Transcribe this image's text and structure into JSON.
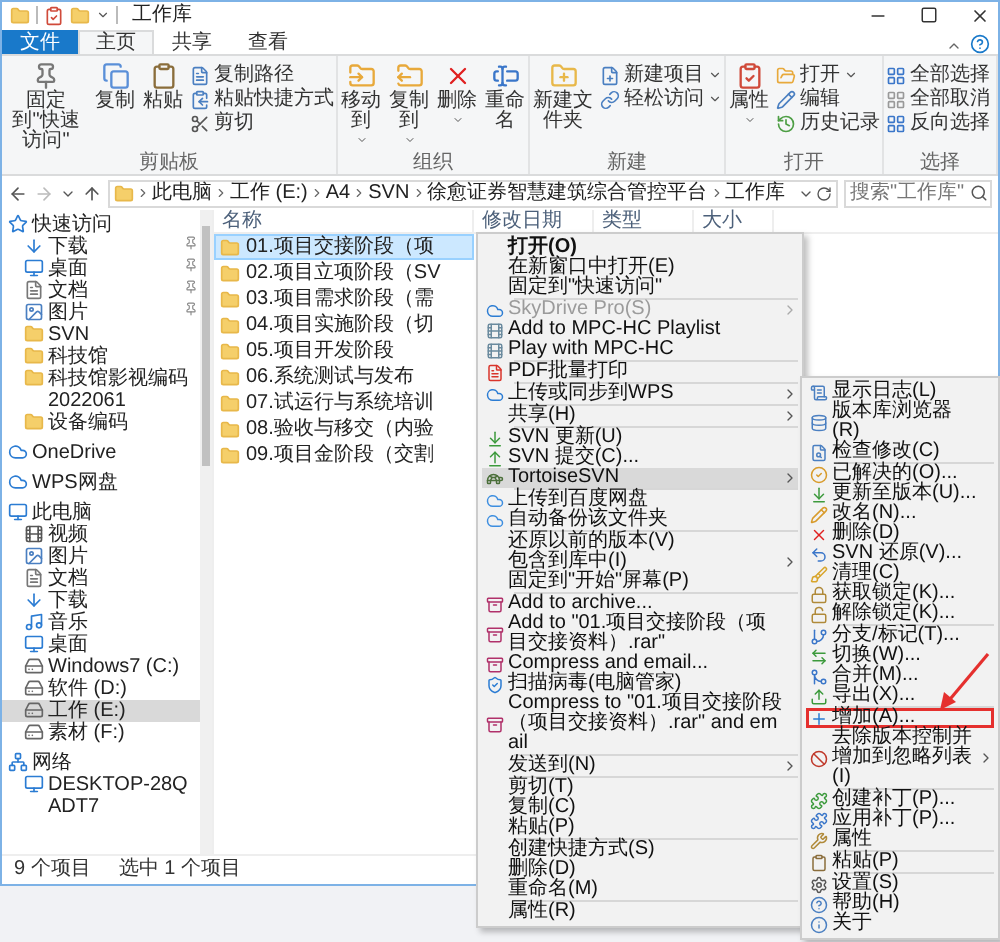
{
  "window": {
    "title": "工作库"
  },
  "ribbon_tabs": [
    {
      "label": "文件",
      "kind": "file",
      "selected": false
    },
    {
      "label": "主页",
      "kind": "tab",
      "selected": true
    },
    {
      "label": "共享",
      "kind": "tab",
      "selected": false
    },
    {
      "label": "查看",
      "kind": "tab",
      "selected": false
    }
  ],
  "ribbon": {
    "groups": [
      {
        "label": "剪贴板",
        "items": [
          {
            "kind": "large",
            "label": "固定到\"快速访问\"",
            "dropdown": false
          },
          {
            "kind": "large",
            "label": "复制",
            "dropdown": false
          },
          {
            "kind": "large",
            "label": "粘贴",
            "dropdown": false
          },
          {
            "kind": "small",
            "label": "复制路径",
            "dropdown": false
          },
          {
            "kind": "small",
            "label": "粘贴快捷方式",
            "dropdown": false
          },
          {
            "kind": "small",
            "label": "剪切",
            "dropdown": false
          }
        ]
      },
      {
        "label": "组织",
        "items": [
          {
            "kind": "large",
            "label": "移动到",
            "dropdown": true
          },
          {
            "kind": "large",
            "label": "复制到",
            "dropdown": true
          },
          {
            "kind": "large",
            "label": "删除",
            "dropdown": true
          },
          {
            "kind": "large",
            "label": "重命名",
            "dropdown": false
          }
        ]
      },
      {
        "label": "新建",
        "items": [
          {
            "kind": "large",
            "label": "新建文件夹",
            "dropdown": false
          },
          {
            "kind": "small",
            "label": "新建项目",
            "dropdown": true
          },
          {
            "kind": "small",
            "label": "轻松访问",
            "dropdown": true
          }
        ]
      },
      {
        "label": "打开",
        "items": [
          {
            "kind": "large",
            "label": "属性",
            "dropdown": true
          },
          {
            "kind": "small",
            "label": "打开",
            "dropdown": true
          },
          {
            "kind": "small",
            "label": "编辑",
            "dropdown": false
          },
          {
            "kind": "small",
            "label": "历史记录",
            "dropdown": false
          }
        ]
      },
      {
        "label": "选择",
        "items": [
          {
            "kind": "small",
            "label": "全部选择",
            "dropdown": false
          },
          {
            "kind": "small",
            "label": "全部取消",
            "dropdown": false
          },
          {
            "kind": "small",
            "label": "反向选择",
            "dropdown": false
          }
        ]
      }
    ]
  },
  "address": {
    "segments": [
      "此电脑",
      "工作 (E:)",
      "A4",
      "SVN",
      "徐愈证券智慧建筑综合管控平台",
      "工作库"
    ],
    "search_placeholder": "搜索\"工作库\""
  },
  "navigation": [
    {
      "label": "快速访问",
      "selected": false,
      "children": [
        {
          "label": "下载",
          "selected": false,
          "pinned": true
        },
        {
          "label": "桌面",
          "selected": false,
          "pinned": true
        },
        {
          "label": "文档",
          "selected": false,
          "pinned": true
        },
        {
          "label": "图片",
          "selected": false,
          "pinned": true
        },
        {
          "label": "SVN",
          "selected": false,
          "pinned": false
        },
        {
          "label": "科技馆",
          "selected": false,
          "pinned": false
        },
        {
          "label": "科技馆影视编码2022061",
          "selected": false,
          "pinned": false
        },
        {
          "label": "设备编码",
          "selected": false,
          "pinned": false
        }
      ]
    },
    {
      "label": "OneDrive",
      "selected": false
    },
    {
      "label": "WPS网盘",
      "selected": false
    },
    {
      "label": "此电脑",
      "selected": false,
      "children": [
        {
          "label": "视频",
          "selected": false
        },
        {
          "label": "图片",
          "selected": false
        },
        {
          "label": "文档",
          "selected": false
        },
        {
          "label": "下载",
          "selected": false
        },
        {
          "label": "音乐",
          "selected": false
        },
        {
          "label": "桌面",
          "selected": false
        },
        {
          "label": "Windows7 (C:)",
          "selected": false
        },
        {
          "label": "软件 (D:)",
          "selected": false
        },
        {
          "label": "工作 (E:)",
          "selected": true
        },
        {
          "label": "素材 (F:)",
          "selected": false
        }
      ]
    },
    {
      "label": "网络",
      "selected": false,
      "children": [
        {
          "label": "DESKTOP-28QADT7",
          "selected": false
        }
      ]
    }
  ],
  "file_list": {
    "columns": [
      "名称",
      "修改日期",
      "类型",
      "大小"
    ],
    "rows": [
      {
        "name": "01.项目交接阶段（项",
        "selected": true
      },
      {
        "name": "02.项目立项阶段（SV",
        "selected": false
      },
      {
        "name": "03.项目需求阶段（需",
        "selected": false
      },
      {
        "name": "04.项目实施阶段（切",
        "selected": false
      },
      {
        "name": "05.项目开发阶段",
        "selected": false
      },
      {
        "name": "06.系统测试与发布",
        "selected": false
      },
      {
        "name": "07.试运行与系统培训",
        "selected": false
      },
      {
        "name": "08.验收与移交（内验",
        "selected": false
      },
      {
        "name": "09.项目金阶段（交割",
        "selected": false
      }
    ]
  },
  "status_bar": {
    "count": "9 个项目",
    "selection": "选中 1 个项目"
  },
  "context_menu": [
    {
      "kind": "item",
      "label": "打开(O)",
      "default": true,
      "disabled": false,
      "submenu": false,
      "highlighted": false
    },
    {
      "kind": "item",
      "label": "在新窗口中打开(E)",
      "default": false,
      "disabled": false,
      "submenu": false,
      "highlighted": false
    },
    {
      "kind": "item",
      "label": "固定到\"快速访问\"",
      "default": false,
      "disabled": false,
      "submenu": false,
      "highlighted": false
    },
    {
      "kind": "separator"
    },
    {
      "kind": "item",
      "label": "SkyDrive Pro(S)",
      "default": false,
      "disabled": true,
      "submenu": true,
      "highlighted": false
    },
    {
      "kind": "item",
      "label": "Add to MPC-HC Playlist",
      "default": false,
      "disabled": false,
      "submenu": false,
      "highlighted": false
    },
    {
      "kind": "item",
      "label": "Play with MPC-HC",
      "default": false,
      "disabled": false,
      "submenu": false,
      "highlighted": false
    },
    {
      "kind": "separator"
    },
    {
      "kind": "item",
      "label": "PDF批量打印",
      "default": false,
      "disabled": false,
      "submenu": false,
      "highlighted": false
    },
    {
      "kind": "separator"
    },
    {
      "kind": "item",
      "label": "上传或同步到WPS",
      "default": false,
      "disabled": false,
      "submenu": true,
      "highlighted": false
    },
    {
      "kind": "separator"
    },
    {
      "kind": "item",
      "label": "共享(H)",
      "default": false,
      "disabled": false,
      "submenu": true,
      "highlighted": false
    },
    {
      "kind": "separator"
    },
    {
      "kind": "item",
      "label": "SVN 更新(U)",
      "default": false,
      "disabled": false,
      "submenu": false,
      "highlighted": false
    },
    {
      "kind": "item",
      "label": "SVN 提交(C)...",
      "default": false,
      "disabled": false,
      "submenu": false,
      "highlighted": false
    },
    {
      "kind": "item",
      "label": "TortoiseSVN",
      "default": false,
      "disabled": false,
      "submenu": true,
      "highlighted": true
    },
    {
      "kind": "separator"
    },
    {
      "kind": "item",
      "label": "上传到百度网盘",
      "default": false,
      "disabled": false,
      "submenu": false,
      "highlighted": false
    },
    {
      "kind": "item",
      "label": "自动备份该文件夹",
      "default": false,
      "disabled": false,
      "submenu": false,
      "highlighted": false
    },
    {
      "kind": "separator"
    },
    {
      "kind": "item",
      "label": "还原以前的版本(V)",
      "default": false,
      "disabled": false,
      "submenu": false,
      "highlighted": false
    },
    {
      "kind": "item",
      "label": "包含到库中(I)",
      "default": false,
      "disabled": false,
      "submenu": true,
      "highlighted": false
    },
    {
      "kind": "item",
      "label": "固定到\"开始\"屏幕(P)",
      "default": false,
      "disabled": false,
      "submenu": false,
      "highlighted": false
    },
    {
      "kind": "separator"
    },
    {
      "kind": "item",
      "label": "Add to archive...",
      "default": false,
      "disabled": false,
      "submenu": false,
      "highlighted": false
    },
    {
      "kind": "item",
      "label": "Add to \"01.项目交接阶段（项目交接资料）.rar\"",
      "default": false,
      "disabled": false,
      "submenu": false,
      "highlighted": false
    },
    {
      "kind": "item",
      "label": "Compress and email...",
      "default": false,
      "disabled": false,
      "submenu": false,
      "highlighted": false
    },
    {
      "kind": "item",
      "label": "扫描病毒(电脑管家)",
      "default": false,
      "disabled": false,
      "submenu": false,
      "highlighted": false
    },
    {
      "kind": "item",
      "label": "Compress to \"01.项目交接阶段（项目交接资料）.rar\" and email",
      "default": false,
      "disabled": false,
      "submenu": false,
      "highlighted": false
    },
    {
      "kind": "separator"
    },
    {
      "kind": "item",
      "label": "发送到(N)",
      "default": false,
      "disabled": false,
      "submenu": true,
      "highlighted": false
    },
    {
      "kind": "separator"
    },
    {
      "kind": "item",
      "label": "剪切(T)",
      "default": false,
      "disabled": false,
      "submenu": false,
      "highlighted": false
    },
    {
      "kind": "item",
      "label": "复制(C)",
      "default": false,
      "disabled": false,
      "submenu": false,
      "highlighted": false
    },
    {
      "kind": "item",
      "label": "粘贴(P)",
      "default": false,
      "disabled": false,
      "submenu": false,
      "highlighted": false
    },
    {
      "kind": "separator"
    },
    {
      "kind": "item",
      "label": "创建快捷方式(S)",
      "default": false,
      "disabled": false,
      "submenu": false,
      "highlighted": false
    },
    {
      "kind": "item",
      "label": "删除(D)",
      "default": false,
      "disabled": false,
      "submenu": false,
      "highlighted": false
    },
    {
      "kind": "item",
      "label": "重命名(M)",
      "default": false,
      "disabled": false,
      "submenu": false,
      "highlighted": false
    },
    {
      "kind": "separator"
    },
    {
      "kind": "item",
      "label": "属性(R)",
      "default": false,
      "disabled": false,
      "submenu": false,
      "highlighted": false
    }
  ],
  "tortoise_submenu": [
    {
      "kind": "item",
      "label": "显示日志(L)",
      "submenu": false,
      "annotated": false
    },
    {
      "kind": "item",
      "label": "版本库浏览器(R)",
      "submenu": false,
      "annotated": false
    },
    {
      "kind": "item",
      "label": "检查修改(C)",
      "submenu": false,
      "annotated": false
    },
    {
      "kind": "separator"
    },
    {
      "kind": "item",
      "label": "已解决的(O)...",
      "submenu": false,
      "annotated": false
    },
    {
      "kind": "item",
      "label": "更新至版本(U)...",
      "submenu": false,
      "annotated": false
    },
    {
      "kind": "item",
      "label": "改名(N)...",
      "submenu": false,
      "annotated": false
    },
    {
      "kind": "item",
      "label": "删除(D)",
      "submenu": false,
      "annotated": false
    },
    {
      "kind": "item",
      "label": "SVN 还原(V)...",
      "submenu": false,
      "annotated": false
    },
    {
      "kind": "item",
      "label": "清理(C)",
      "submenu": false,
      "annotated": false
    },
    {
      "kind": "item",
      "label": "获取锁定(K)...",
      "submenu": false,
      "annotated": false
    },
    {
      "kind": "item",
      "label": "解除锁定(K)...",
      "submenu": false,
      "annotated": false
    },
    {
      "kind": "separator"
    },
    {
      "kind": "item",
      "label": "分支/标记(T)...",
      "submenu": false,
      "annotated": false
    },
    {
      "kind": "item",
      "label": "切换(W)...",
      "submenu": false,
      "annotated": false
    },
    {
      "kind": "item",
      "label": "合并(M)...",
      "submenu": false,
      "annotated": false
    },
    {
      "kind": "item",
      "label": "导出(X)...",
      "submenu": false,
      "annotated": false
    },
    {
      "kind": "separator"
    },
    {
      "kind": "item",
      "label": "增加(A)...",
      "submenu": false,
      "annotated": true
    },
    {
      "kind": "item",
      "label": "去除版本控制并增加到忽略列表(I)",
      "submenu": true,
      "annotated": false
    },
    {
      "kind": "separator"
    },
    {
      "kind": "item",
      "label": "创建补丁(P)...",
      "submenu": false,
      "annotated": false
    },
    {
      "kind": "item",
      "label": "应用补丁(P)...",
      "submenu": false,
      "annotated": false
    },
    {
      "kind": "item",
      "label": "属性",
      "submenu": false,
      "annotated": false
    },
    {
      "kind": "separator"
    },
    {
      "kind": "item",
      "label": "粘贴(P)",
      "submenu": false,
      "annotated": false
    },
    {
      "kind": "separator"
    },
    {
      "kind": "item",
      "label": "设置(S)",
      "submenu": false,
      "annotated": false
    },
    {
      "kind": "item",
      "label": "帮助(H)",
      "submenu": false,
      "annotated": false
    },
    {
      "kind": "item",
      "label": "关于",
      "submenu": false,
      "annotated": false
    }
  ]
}
